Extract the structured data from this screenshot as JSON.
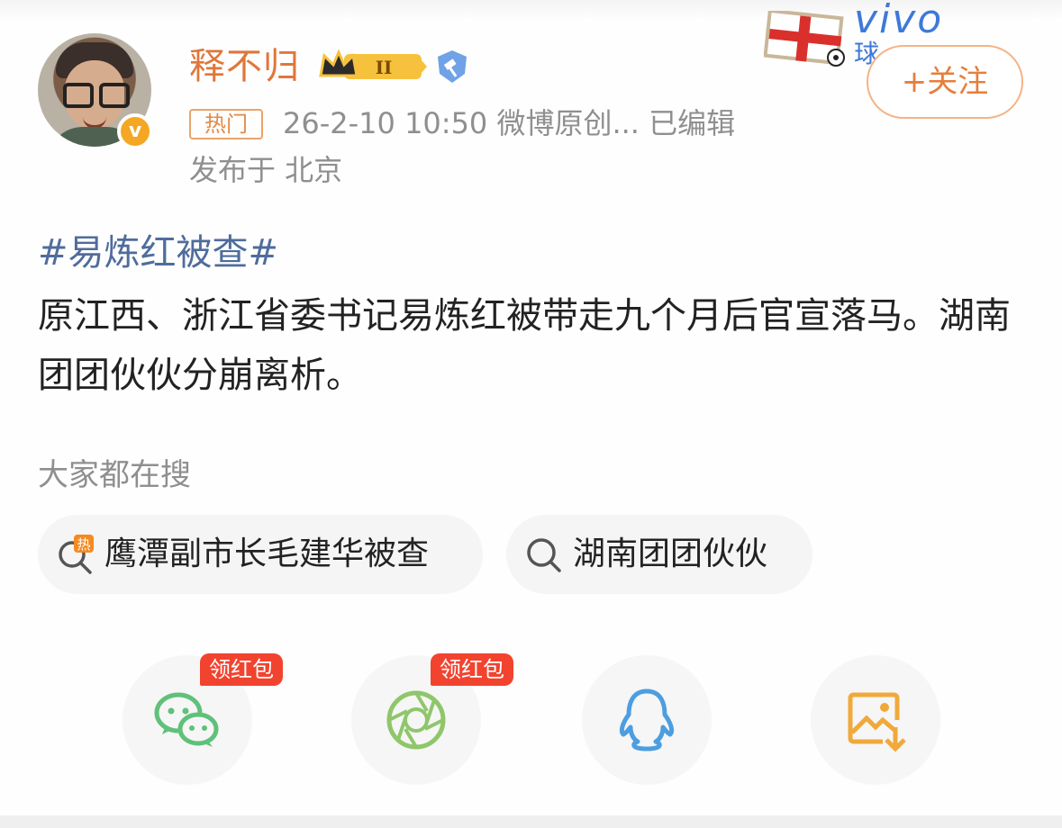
{
  "post": {
    "username": "释不归",
    "level_badge": "II",
    "hot_tag": "热门",
    "meta": "26-2-10 10:50  微博原创...  已编辑",
    "location": "发布于 北京",
    "follow_label": "+关注",
    "hashtag": "#易炼红被查#",
    "content": "原江西、浙江省委书记易炼红被带走九个月后官宣落马。湖南团团伙伙分崩离析。"
  },
  "ad": {
    "brand": "vivo",
    "sub": "球"
  },
  "search": {
    "title": "大家都在搜",
    "chips": [
      {
        "label": "鹰潭副市长毛建华被查",
        "icon": "hot-search-icon"
      },
      {
        "label": "湖南团团伙伙",
        "icon": "search-icon"
      }
    ]
  },
  "share": {
    "badge": "领红包",
    "targets": [
      {
        "name": "wechat",
        "icon": "wechat-icon"
      },
      {
        "name": "moments",
        "icon": "moments-icon"
      },
      {
        "name": "qq",
        "icon": "qq-icon"
      },
      {
        "name": "save-image",
        "icon": "save-image-icon"
      }
    ]
  },
  "colors": {
    "username": "#e0763a",
    "hashtag": "#4f6c9c",
    "follow": "#e57f3c",
    "badge_red": "#f2432f",
    "wechat": "#5fc17a",
    "moments": "#8fc66a",
    "qq": "#4d9ee0",
    "save": "#f0a93a"
  }
}
